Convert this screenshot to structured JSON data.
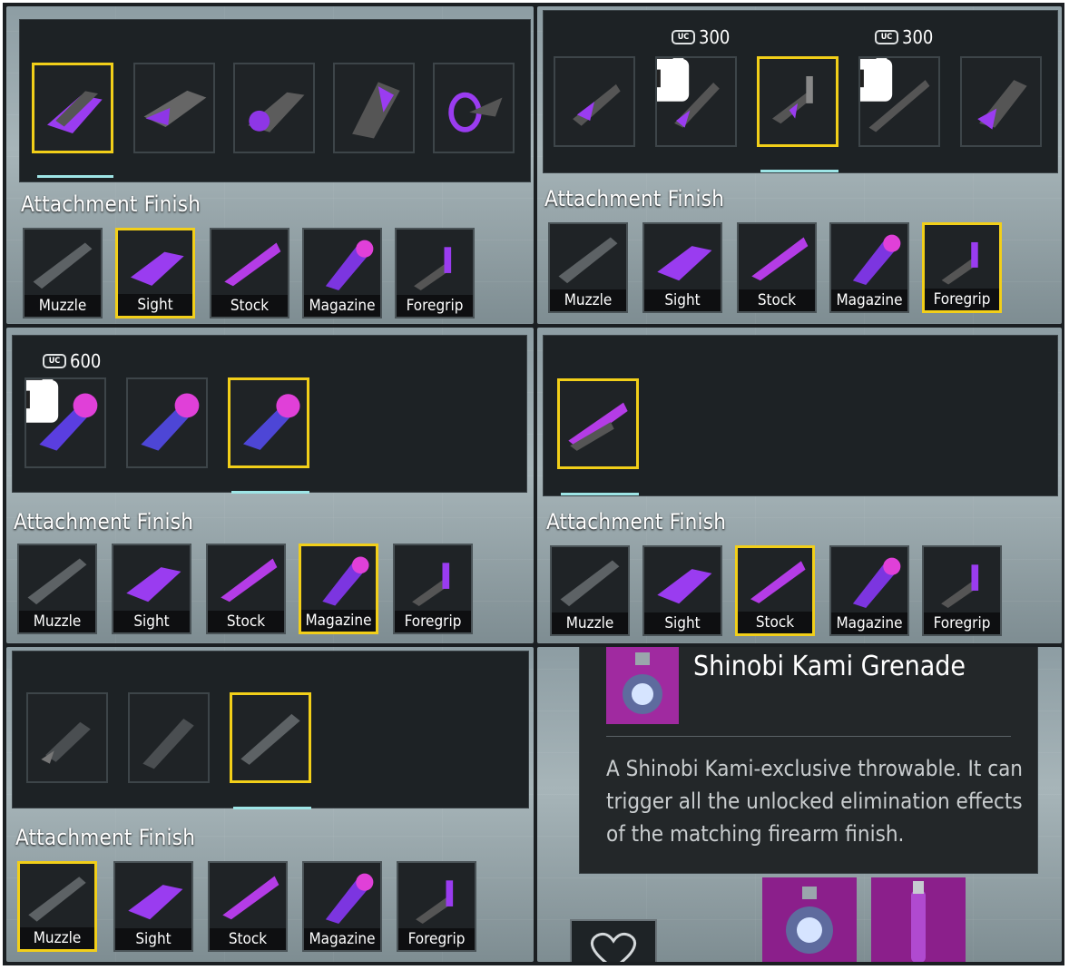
{
  "section_title": "Attachment Finish",
  "categories": [
    "Muzzle",
    "Sight",
    "Stock",
    "Magazine",
    "Foregrip"
  ],
  "currency_icon": "UC",
  "prices": {
    "p300": "300",
    "p600": "600"
  },
  "colors": {
    "selected": "#f2cf19",
    "accent": "#9ee5e6",
    "neon": "#b63cf0",
    "panel": "#1d2225"
  },
  "grenade": {
    "name": "Shinobi Kami Grenade",
    "description_lines": [
      "A Shinobi Kami-exclusive throwable. It can",
      "trigger all the unlocked elimination effects",
      "of the matching firearm finish."
    ]
  }
}
